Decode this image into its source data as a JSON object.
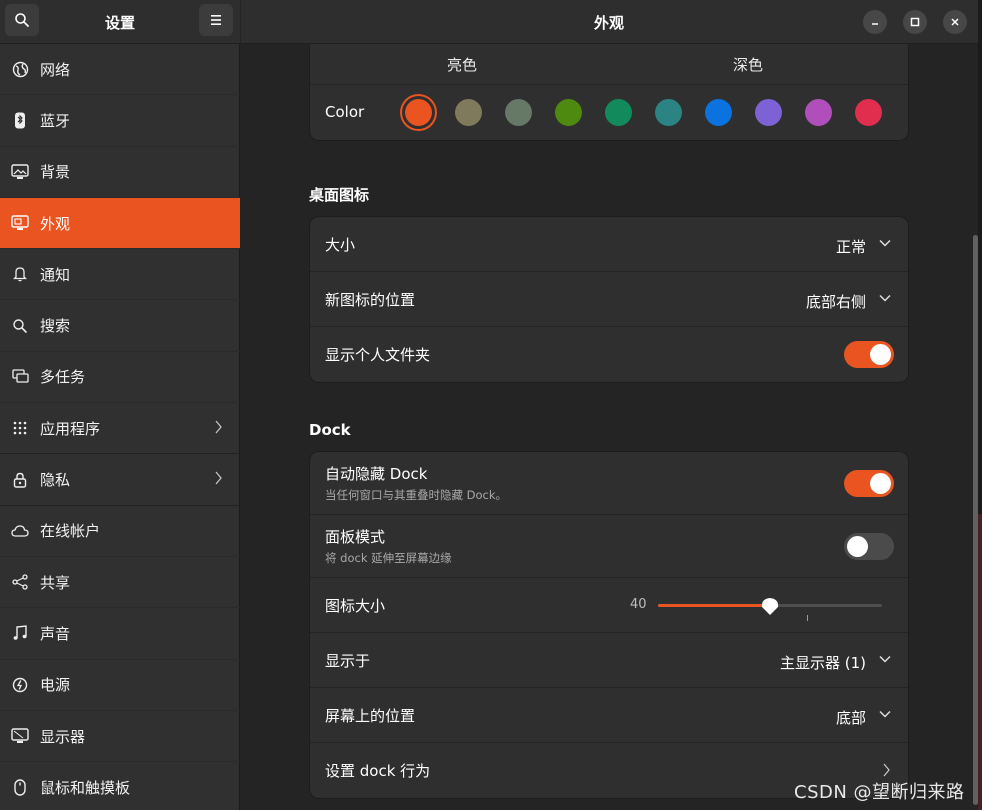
{
  "sidebar": {
    "title": "设置",
    "items": [
      {
        "label": "网络",
        "icon": "globe-icon"
      },
      {
        "label": "蓝牙",
        "icon": "bluetooth-icon"
      },
      {
        "label": "背景",
        "icon": "background-icon"
      },
      {
        "label": "外观",
        "icon": "appearance-icon",
        "active": true
      },
      {
        "label": "通知",
        "icon": "bell-icon"
      },
      {
        "label": "搜索",
        "icon": "search-icon"
      },
      {
        "label": "多任务",
        "icon": "multitask-icon"
      },
      {
        "label": "应用程序",
        "icon": "apps-grid-icon",
        "has_submenu": true
      },
      {
        "label": "隐私",
        "icon": "lock-icon",
        "has_submenu": true
      },
      {
        "label": "在线帐户",
        "icon": "cloud-icon"
      },
      {
        "label": "共享",
        "icon": "share-icon"
      },
      {
        "label": "声音",
        "icon": "music-note-icon"
      },
      {
        "label": "电源",
        "icon": "power-icon"
      },
      {
        "label": "显示器",
        "icon": "display-icon"
      },
      {
        "label": "鼠标和触摸板",
        "icon": "mouse-icon"
      }
    ]
  },
  "main": {
    "title": "外观",
    "theme": {
      "light_label": "亮色",
      "dark_label": "深色",
      "color_label": "Color",
      "colors": [
        "#e95420",
        "#7f7a5c",
        "#667866",
        "#4e8a10",
        "#128a5c",
        "#2b8484",
        "#0a73e0",
        "#7c62d5",
        "#b04fbc",
        "#e22e4e"
      ],
      "selected_index": 0
    },
    "desktop_icons": {
      "title": "桌面图标",
      "size_label": "大小",
      "size_value": "正常",
      "new_icon_label": "新图标的位置",
      "new_icon_value": "底部右侧",
      "show_home_label": "显示个人文件夹",
      "show_home_on": true
    },
    "dock": {
      "title": "Dock",
      "autohide_label": "自动隐藏 Dock",
      "autohide_sub": "当任何窗口与其重叠时隐藏 Dock。",
      "autohide_on": true,
      "panel_label": "面板模式",
      "panel_sub": "将 dock 延伸至屏幕边缘",
      "panel_on": false,
      "icon_size_label": "图标大小",
      "icon_size_value": "40",
      "icon_size_fraction": 0.5,
      "show_on_label": "显示于",
      "show_on_value": "主显示器 (1)",
      "position_label": "屏幕上的位置",
      "position_value": "底部",
      "behavior_label": "设置 dock 行为"
    }
  },
  "watermark": "CSDN @望断归来路",
  "colors": {
    "accent": "#e95420"
  }
}
